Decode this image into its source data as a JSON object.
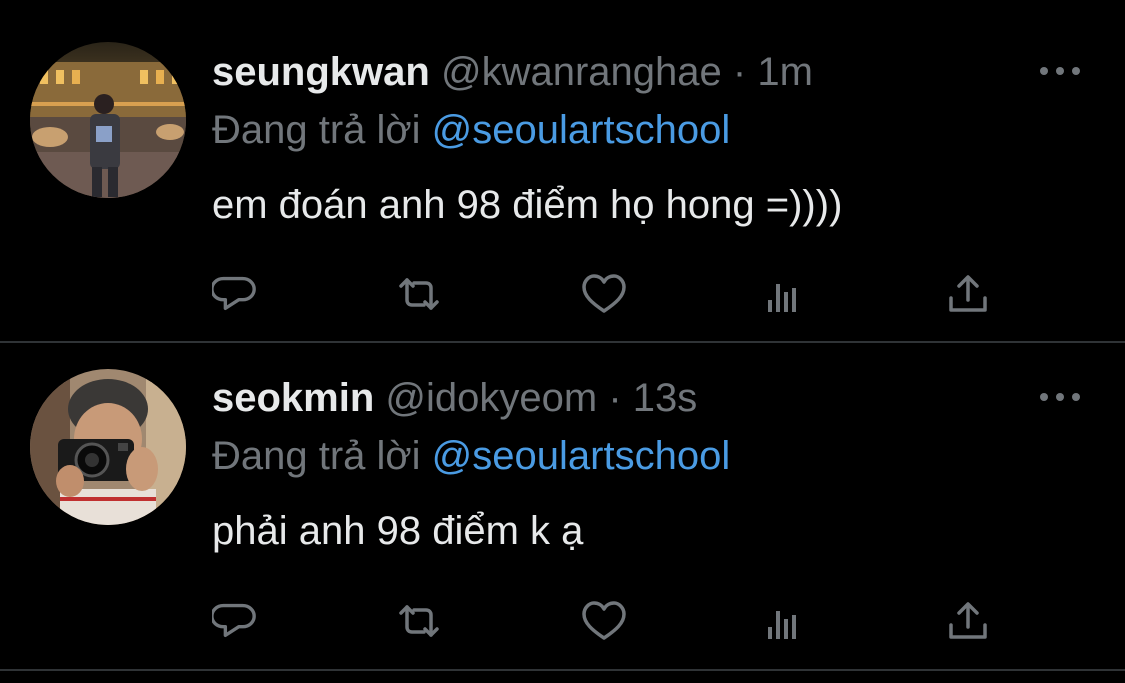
{
  "tweets": [
    {
      "display_name": "seungkwan",
      "handle": "@kwanranghae",
      "separator": "·",
      "time": "1m",
      "replying_label": "Đang trả lời",
      "replying_to": "@seoulartschool",
      "text": "em đoán anh 98 điểm họ hong =))))",
      "avatar": "avatar-photo-night-street",
      "actions": [
        "reply-icon",
        "retweet-icon",
        "like-icon",
        "views-icon",
        "share-icon"
      ]
    },
    {
      "display_name": "seokmin",
      "handle": "@idokyeom",
      "separator": "·",
      "time": "13s",
      "replying_label": "Đang trả lời",
      "replying_to": "@seoulartschool",
      "text": "phải anh 98 điểm k ạ",
      "avatar": "avatar-photo-camera-selfie",
      "actions": [
        "reply-icon",
        "retweet-icon",
        "like-icon",
        "views-icon",
        "share-icon"
      ]
    }
  ],
  "colors": {
    "background": "#000000",
    "primary_text": "#e7e9ea",
    "secondary_text": "#71767b",
    "link": "#4a9be3",
    "divider": "#2f3336"
  }
}
